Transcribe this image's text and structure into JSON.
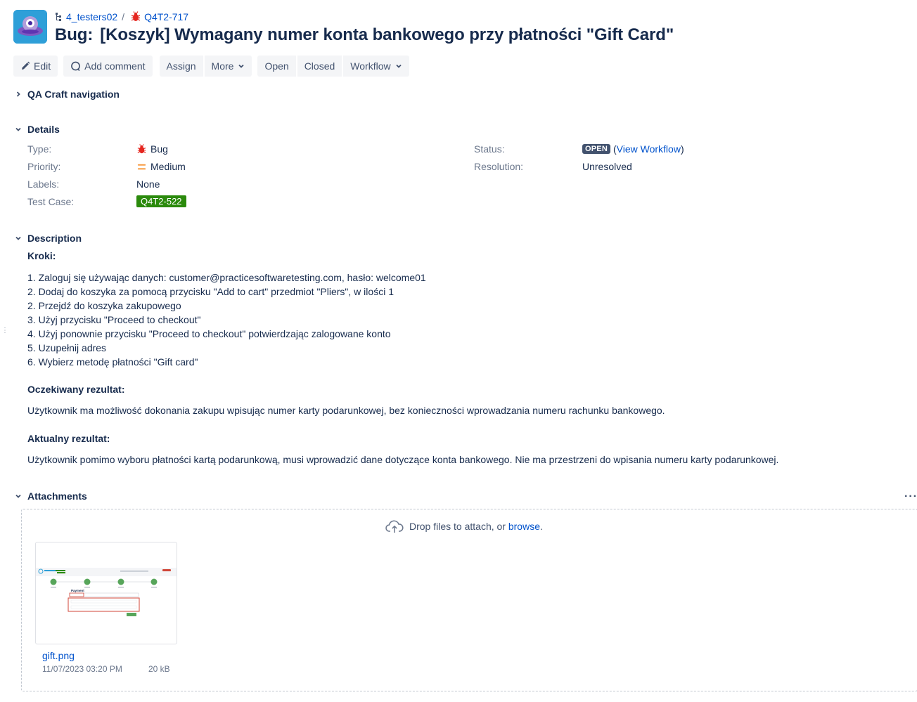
{
  "breadcrumb": {
    "project": "4_testers02",
    "separator": "/",
    "issue_key": "Q4T2-717"
  },
  "issue": {
    "type_prefix": "Bug:",
    "summary": "[Koszyk] Wymagany numer konta bankowego przy płatności \"Gift Card\""
  },
  "toolbar": {
    "edit": "Edit",
    "add_comment": "Add comment",
    "assign": "Assign",
    "more": "More",
    "open": "Open",
    "closed": "Closed",
    "workflow": "Workflow"
  },
  "sections": {
    "qa_nav": "QA Craft navigation",
    "details": "Details",
    "description": "Description",
    "attachments": "Attachments"
  },
  "details": {
    "type_label": "Type:",
    "type_value": "Bug",
    "priority_label": "Priority:",
    "priority_value": "Medium",
    "labels_label": "Labels:",
    "labels_value": "None",
    "testcase_label": "Test Case:",
    "testcase_value": "Q4T2-522",
    "status_label": "Status:",
    "status_value": "OPEN",
    "status_open_paren": "(",
    "status_link": "View Workflow",
    "status_close_paren": ")",
    "resolution_label": "Resolution:",
    "resolution_value": "Unresolved"
  },
  "description": {
    "steps_heading": "Kroki:",
    "steps": [
      "1. Zaloguj się używając danych: customer@practicesoftwaretesting.com, hasło: welcome01",
      "2. Dodaj do koszyka za pomocą przycisku \"Add to cart\" przedmiot \"Pliers\", w ilości 1",
      "2. Przejdź do koszyka zakupowego",
      "3. Użyj przycisku \"Proceed to checkout\"",
      "4. Użyj ponownie przycisku \"Proceed to checkout\" potwierdzając zalogowane konto",
      "5. Uzupełnij adres",
      "6. Wybierz metodę płatności \"Gift card\""
    ],
    "expected_heading": "Oczekiwany rezultat:",
    "expected_text": "Użytkownik ma możliwość dokonania zakupu wpisując numer karty podarunkowej, bez konieczności wprowadzania numeru rachunku bankowego.",
    "actual_heading": "Aktualny rezultat:",
    "actual_text": "Użytkownik pomimo wyboru płatności kartą podarunkową, musi wprowadzić dane dotyczące konta bankowego. Nie ma przestrzeni do wpisania numeru karty podarunkowej."
  },
  "attachments": {
    "drop_text": "Drop files to attach, or",
    "browse": "browse",
    "browse_period": ".",
    "file_name": "gift.png",
    "file_date": "11/07/2023 03:20 PM",
    "file_size": "20 kB",
    "thumb_title": "Payment"
  },
  "colors": {
    "link": "#0052cc",
    "text": "#172b4d",
    "muted": "#6b778c",
    "button_bg": "#f4f5f7",
    "status_lozenge": "#42526e",
    "testcase_badge": "#2b8a0c",
    "bug_red": "#e5261f",
    "priority_orange": "#f79232"
  },
  "icons": {
    "project": "project-tree-icon",
    "bug": "bug-icon",
    "edit": "pencil-icon",
    "comment": "comment-icon",
    "priority": "priority-medium-icon",
    "upload": "cloud-upload-icon",
    "more": "more-dots-icon"
  }
}
